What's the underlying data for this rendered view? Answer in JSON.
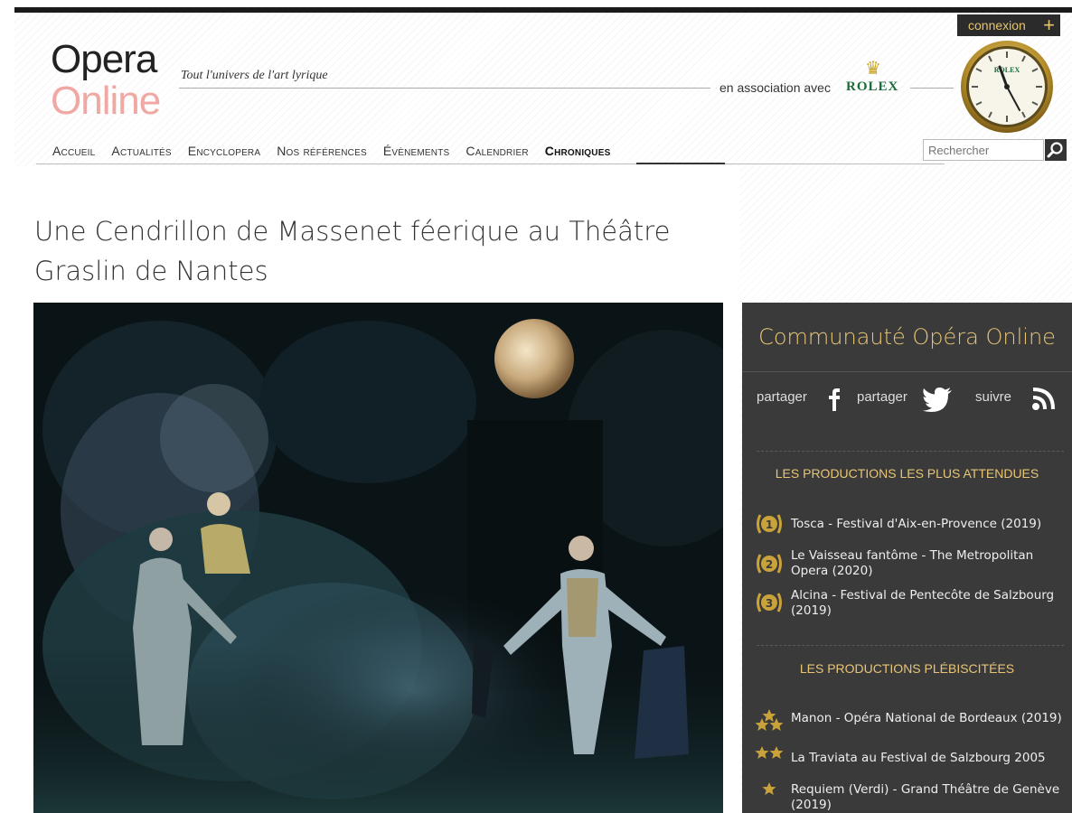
{
  "header": {
    "logo_line1": "Opera",
    "logo_line2": "Online",
    "tagline": "Tout l'univers de l'art lyrique",
    "association_text": "en association avec",
    "sponsor": "ROLEX",
    "sponsor_crown": "♛",
    "clock_brand": "ROLEX",
    "login_label": "connexion",
    "login_plus": "+"
  },
  "nav": {
    "items": [
      "Accueil",
      "Actualités",
      "Encyclopera",
      "Nos références",
      "Évènements",
      "Calendrier",
      "Chroniques"
    ],
    "active_index": 6
  },
  "search": {
    "placeholder": "Rechercher",
    "icon": "magnifier-icon"
  },
  "article": {
    "title": "Une Cendrillon de Massenet féerique au Théâtre Graslin de Nantes"
  },
  "sidebar": {
    "title": "Communauté Opéra Online",
    "share_fb": "partager",
    "share_tw": "partager",
    "follow": "suivre",
    "section1": {
      "heading": "LES PRODUCTIONS LES PLUS ATTENDUES",
      "items": [
        {
          "rank": "1",
          "text": "Tosca - Festival d'Aix-en-Provence (2019)"
        },
        {
          "rank": "2",
          "text": "Le Vaisseau fantôme - The Metropolitan Opera (2020)"
        },
        {
          "rank": "3",
          "text": "Alcina - Festival de Pentecôte de Salzbourg (2019)"
        }
      ]
    },
    "section2": {
      "heading": "LES PRODUCTIONS PLÉBISCITÉES",
      "items": [
        {
          "stars": 3,
          "text": "Manon - Opéra National de Bordeaux (2019)"
        },
        {
          "stars": 2,
          "text": "La Traviata au Festival de Salzbourg 2005"
        },
        {
          "stars": 1,
          "text": "Requiem (Verdi) - Grand Théâtre de Genève (2019)"
        }
      ]
    }
  },
  "colors": {
    "accent_gold": "#e8c576",
    "sidebar_bg": "#3a3a3a",
    "logo_pink": "#f0a8a4",
    "rolex_green": "#1c6b3b"
  }
}
